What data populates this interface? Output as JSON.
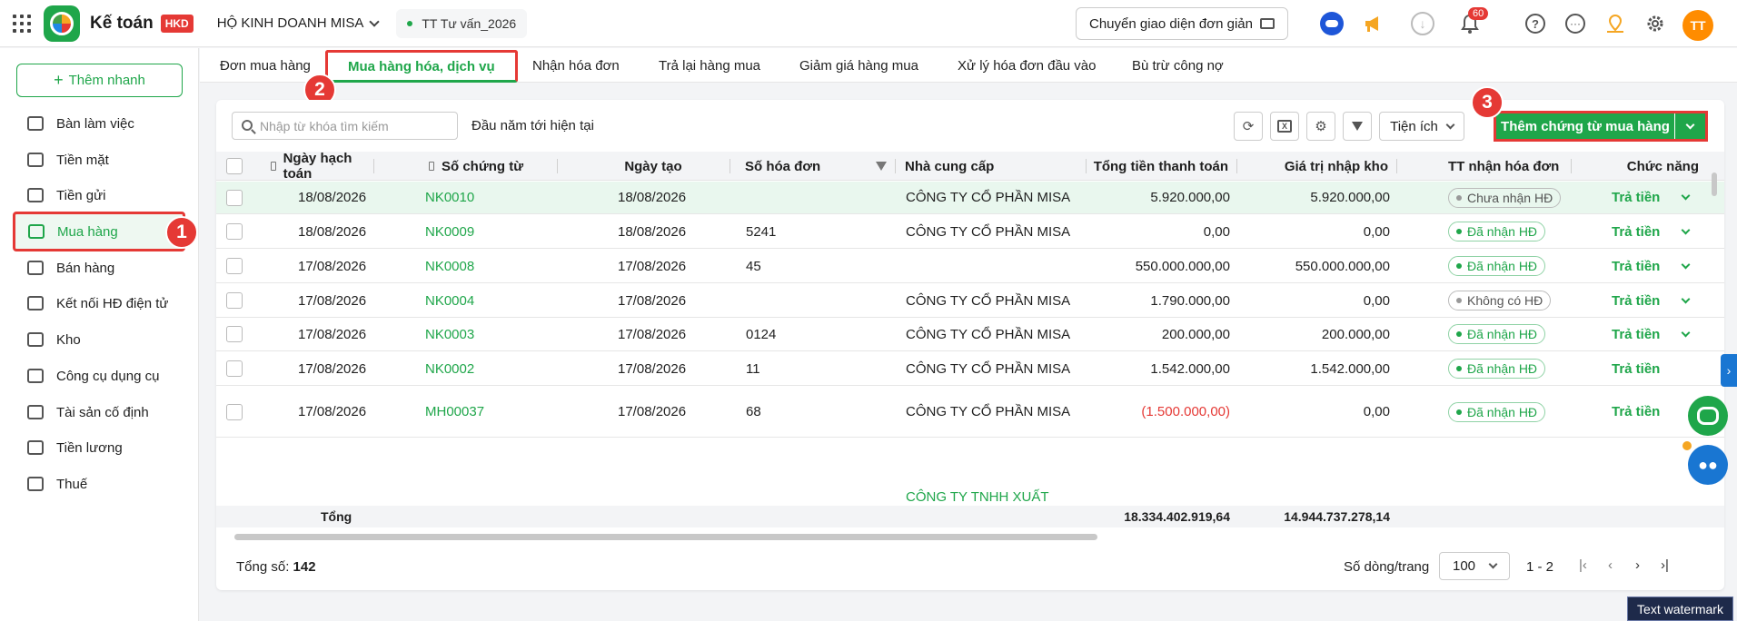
{
  "topbar": {
    "brand": "Kế toán",
    "brand_badge": "HKD",
    "company": "HỘ KINH DOANH MISA",
    "workspace": "TT Tư vấn_2026",
    "switch_ui_label": "Chuyển giao diện đơn giản",
    "notification_count": "60",
    "avatar_initials": "TT"
  },
  "sidebar": {
    "quick_add_label": "Thêm nhanh",
    "items": [
      {
        "label": "Bàn làm việc"
      },
      {
        "label": "Tiền mặt"
      },
      {
        "label": "Tiền gửi"
      },
      {
        "label": "Mua hàng"
      },
      {
        "label": "Bán hàng"
      },
      {
        "label": "Kết nối HĐ điện tử"
      },
      {
        "label": "Kho"
      },
      {
        "label": "Công cụ dụng cụ"
      },
      {
        "label": "Tài sản cố định"
      },
      {
        "label": "Tiền lương"
      },
      {
        "label": "Thuế"
      }
    ]
  },
  "steps": [
    "1",
    "2",
    "3"
  ],
  "tabs": [
    {
      "label": "Đơn mua hàng"
    },
    {
      "label": "Mua hàng hóa, dịch vụ"
    },
    {
      "label": "Nhận hóa đơn"
    },
    {
      "label": "Trả lại hàng mua"
    },
    {
      "label": "Giảm giá hàng mua"
    },
    {
      "label": "Xử lý hóa đơn đầu vào"
    },
    {
      "label": "Bù trừ công nợ"
    }
  ],
  "toolbar": {
    "search_placeholder": "Nhập từ khóa tìm kiếm",
    "period": "Đầu năm tới hiện tại",
    "utility_label": "Tiện ích",
    "add_voucher_label": "Thêm chứng từ mua hàng"
  },
  "table": {
    "columns": {
      "posting_date": "Ngày hạch toán",
      "voucher_no": "Số chứng từ",
      "created_date": "Ngày tạo",
      "invoice_no": "Số hóa đơn",
      "supplier": "Nhà cung cấp",
      "total_payment": "Tổng tiền thanh toán",
      "stock_value": "Giá trị nhập kho",
      "invoice_status": "TT nhận hóa đơn",
      "action": "Chức năng"
    },
    "rows": [
      {
        "posting_date": "18/08/2026",
        "voucher_no": "NK0010",
        "created_date": "18/08/2026",
        "invoice_no": "",
        "supplier": "CÔNG TY CỔ PHẦN MISA",
        "total_payment": "5.920.000,00",
        "stock_value": "5.920.000,00",
        "invoice_status": "Chưa nhận HĐ",
        "action": "Trả tiền"
      },
      {
        "posting_date": "18/08/2026",
        "voucher_no": "NK0009",
        "created_date": "18/08/2026",
        "invoice_no": "5241",
        "supplier": "CÔNG TY CỔ PHẦN MISA",
        "total_payment": "0,00",
        "stock_value": "0,00",
        "invoice_status": "Đã nhận HĐ",
        "action": "Trả tiền"
      },
      {
        "posting_date": "17/08/2026",
        "voucher_no": "NK0008",
        "created_date": "17/08/2026",
        "invoice_no": "45",
        "supplier": "",
        "total_payment": "550.000.000,00",
        "stock_value": "550.000.000,00",
        "invoice_status": "Đã nhận HĐ",
        "action": "Trả tiền"
      },
      {
        "posting_date": "17/08/2026",
        "voucher_no": "NK0004",
        "created_date": "17/08/2026",
        "invoice_no": "",
        "supplier": "CÔNG TY CỔ PHẦN MISA",
        "total_payment": "1.790.000,00",
        "stock_value": "0,00",
        "invoice_status": "Không có HĐ",
        "action": "Trả tiền"
      },
      {
        "posting_date": "17/08/2026",
        "voucher_no": "NK0003",
        "created_date": "17/08/2026",
        "invoice_no": "0124",
        "supplier": "CÔNG TY CỔ PHẦN MISA",
        "total_payment": "200.000,00",
        "stock_value": "200.000,00",
        "invoice_status": "Đã nhận HĐ",
        "action": "Trả tiền"
      },
      {
        "posting_date": "17/08/2026",
        "voucher_no": "NK0002",
        "created_date": "17/08/2026",
        "invoice_no": "11",
        "supplier": "CÔNG TY CỔ PHẦN MISA",
        "total_payment": "1.542.000,00",
        "stock_value": "1.542.000,00",
        "invoice_status": "Đã nhận HĐ",
        "action": "Trả tiền"
      },
      {
        "posting_date": "17/08/2026",
        "voucher_no": "MH00037",
        "created_date": "17/08/2026",
        "invoice_no": "68",
        "supplier": "CÔNG TY CỔ PHẦN MISA",
        "total_payment": "(1.500.000,00)",
        "stock_value": "0,00",
        "invoice_status": "Đã nhận HĐ",
        "action": "Trả tiền"
      }
    ],
    "partial_row_supplier": "CÔNG TY TNHH XUẤT",
    "total_label": "Tổng",
    "total_payment": "18.334.402.919,64",
    "total_stock_value": "14.944.737.278,14"
  },
  "footer": {
    "total_count_label": "Tổng số:",
    "total_count": "142",
    "rows_per_page_label": "Số dòng/trang",
    "rows_per_page": "100",
    "page_range": "1 - 2"
  },
  "watermark": "Text watermark",
  "colors": {
    "accent": "#1fa64a",
    "highlight": "#e53935",
    "negative": "#e53935"
  }
}
